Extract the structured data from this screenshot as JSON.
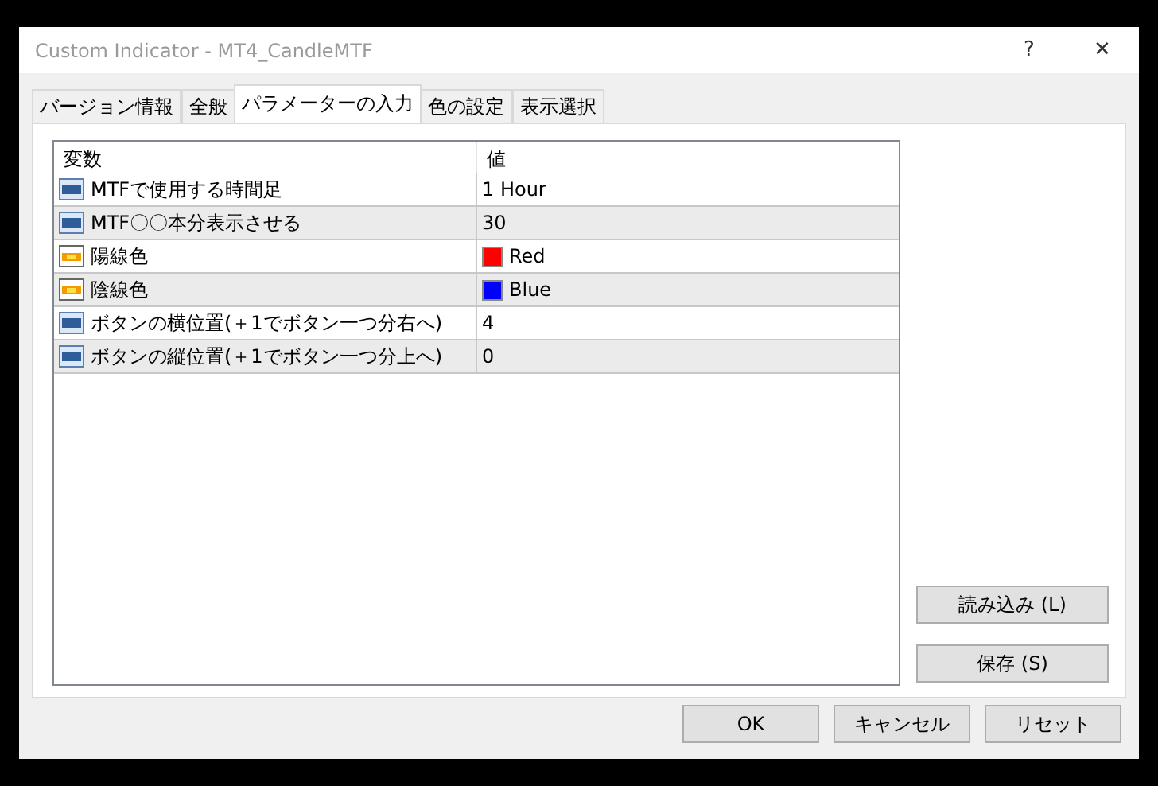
{
  "window": {
    "title": "Custom Indicator - MT4_CandleMTF",
    "help": "?",
    "close": "✕"
  },
  "tabs": [
    {
      "label": "バージョン情報",
      "selected": false
    },
    {
      "label": "全般",
      "selected": false
    },
    {
      "label": "パラメーターの入力",
      "selected": true
    },
    {
      "label": "色の設定",
      "selected": false
    },
    {
      "label": "表示選択",
      "selected": false
    }
  ],
  "table": {
    "columns": [
      "変数",
      "値"
    ],
    "rows": [
      {
        "kind": "number",
        "name": "MTFで使用する時間足",
        "value": "1 Hour"
      },
      {
        "kind": "number",
        "name": "MTF〇〇本分表示させる",
        "value": "30"
      },
      {
        "kind": "color",
        "name": "陽線色",
        "value": "Red",
        "color": "#ff0000"
      },
      {
        "kind": "color",
        "name": "陰線色",
        "value": "Blue",
        "color": "#0000ff"
      },
      {
        "kind": "number",
        "name": "ボタンの横位置(＋1でボタン一つ分右へ)",
        "value": "4"
      },
      {
        "kind": "number",
        "name": "ボタンの縦位置(＋1でボタン一つ分上へ)",
        "value": "0"
      }
    ]
  },
  "side_buttons": [
    "読み込み (L)",
    "保存 (S)"
  ],
  "buttons": [
    "OK",
    "キャンセル",
    "リセット"
  ]
}
